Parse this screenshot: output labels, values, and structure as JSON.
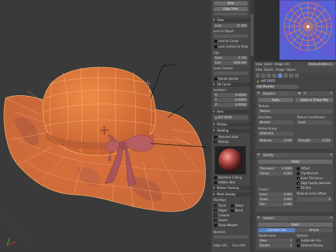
{
  "toolshelf": {
    "top_buttons": [
      "Slide",
      "Edge Slide"
    ],
    "view_section": "View",
    "lens_label": "Lens:",
    "lens_value": "35.000",
    "lock_to_object": "Lock to Object:",
    "lock_to_cursor": "Lock to Cursor",
    "lock_camera_to_view": "Lock Camera to View",
    "clip_label": "Clip:",
    "clip_start_label": "Start:",
    "clip_start_value": "0.100",
    "clip_end_label": "End:",
    "clip_end_value": "1000.000",
    "local_camera": "Local Camera:",
    "render_border": "Render Border",
    "cursor_section": "3D Cursor",
    "location_label": "Location:",
    "x_label": "X:",
    "x_value": "0.00000",
    "y_label": "Y:",
    "y_value": "0.00000",
    "z_label": "Z:",
    "z_value": "0.00000",
    "item_section": "Item",
    "item_name": "HAT BODY",
    "display_section": "Display",
    "shading_section": "Shading",
    "textured_solid": "Textured Solid",
    "matcap": "Matcap",
    "backface_culling": "Backface Culling",
    "hidden_wire": "Hidden Wire",
    "motion_tracking": "Motion Tracking",
    "mesh_display": "Mesh Display",
    "overlays_label": "Overlays:",
    "faces": "Faces",
    "sharp": "Sharp",
    "edges": "Edges",
    "bevel": "Bevel",
    "creases": "Creases",
    "seams": "Seams",
    "show_weights": "Show Weights",
    "normals_label": "Normals:",
    "edge_info": "Edge Info:",
    "face_info": "Face Info:"
  },
  "uv_header": {
    "menus": [
      "View",
      "Select",
      "Image",
      "UVs"
    ],
    "image_name": "WeStudioWork.5..."
  },
  "properties": {
    "header_menus": [
      "View",
      "Search",
      "Image",
      "Object"
    ],
    "object_name": "HAT BODY",
    "add_modifier": "Add Modifier",
    "displace": {
      "name": "Displace",
      "apply": "Apply",
      "apply_shape": "Apply as Shape Key",
      "texture_label": "Texture:",
      "texture_name": "Texture",
      "direction_label": "Direction:",
      "direction_value": "Normal",
      "texcoords_label": "Texture Coordinates:",
      "texcoords_value": "Local",
      "vgroup_label": "Vertex Group:",
      "vgroup_value": "DISPLACE",
      "midlevel_label": "Midlevel:",
      "midlevel_value": "0.000",
      "strength_label": "Strength:",
      "strength_value": "0.250"
    },
    "solidify": {
      "name": "Solidify",
      "apply": "Apply",
      "thickness_label": "Thickness:",
      "thickness_value": "0.0006",
      "offset_label": "Offset:",
      "offset_value": "-1.0000",
      "clamp_label": "Clamp:",
      "clamp_value": "0.000",
      "flip_normals": "Flip Normals",
      "even_thickness": "Even Thickness",
      "high_quality_normals": "High Quality Normals",
      "fill_rim": "Fill Rim",
      "crease_label": "Crease:",
      "inner_label": "Inner:",
      "inner_value": "0.000",
      "outer_label": "Outer:",
      "outer_value": "0.000",
      "rim_label": "Rim:",
      "rim_value": "0.000",
      "material_index_label": "Material Index Offset:",
      "material_index_value": "0"
    },
    "subsurf": {
      "name": "Subsurf",
      "apply": "Apply",
      "tab_catmull": "Catmull-Clark",
      "tab_simple": "Simple",
      "subdivisions_label": "Subdivisions:",
      "view_label": "View:",
      "view_value": "1",
      "render_label": "Render:",
      "render_value": "2",
      "options_label": "Options:",
      "subdivide_uvs": "Subdivide UVs",
      "optimal_display": "Optimal Display"
    }
  },
  "colors": {
    "hat": "#e07a3c",
    "hat_dark": "#b65a2b",
    "wire": "#f2b36a",
    "ribbon": "#b0585a",
    "uv_grid": "#f08a2a",
    "uv_bg": "#3f54c8"
  }
}
